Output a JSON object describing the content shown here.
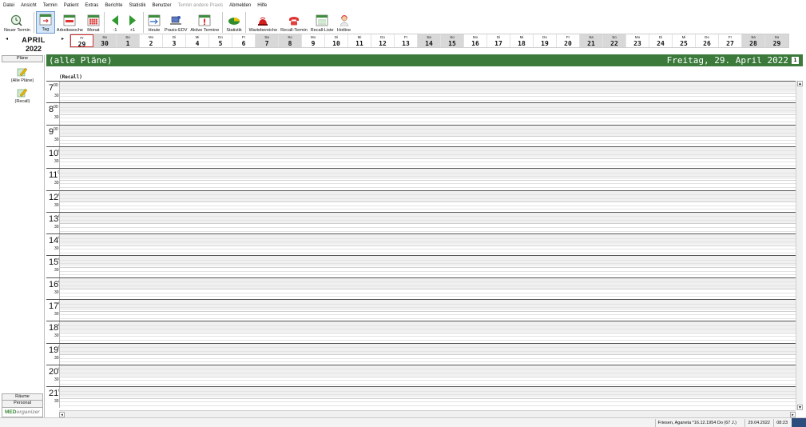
{
  "menu": [
    "Datei",
    "Ansicht",
    "Termin",
    "Patient",
    "Extras",
    "Berichte",
    "Statistik",
    "Benutzer",
    "Termin andere Praxis",
    "Abmelden",
    "Hilfe"
  ],
  "menu_disabled": [
    "Termin andere Praxis"
  ],
  "toolbar": {
    "new_appt": "Neuer Termin",
    "day": "Tag",
    "workweek": "Arbeitswoche",
    "month": "Monat",
    "minus1": "-1",
    "plus1": "+1",
    "today": "Heute",
    "praxis_edv": "Praxis-EDV",
    "active_appts": "Aktive Termine",
    "statistics": "Statistik",
    "waiting_areas": "Wartebereiche",
    "recall_appt": "Recall-Termin",
    "recall_list": "Recall-Liste",
    "hotline": "Hotline"
  },
  "calendar": {
    "month": "APRIL",
    "year": "2022",
    "prev": "◂",
    "next": "▸",
    "days": [
      {
        "dn": "Fr",
        "dd": "29",
        "we": false,
        "sel": true
      },
      {
        "dn": "Sa",
        "dd": "30",
        "we": true
      },
      {
        "dn": "So",
        "dd": "1",
        "we": true
      },
      {
        "dn": "Mo",
        "dd": "2",
        "we": false
      },
      {
        "dn": "Di",
        "dd": "3",
        "we": false
      },
      {
        "dn": "Mi",
        "dd": "4",
        "we": false
      },
      {
        "dn": "Do",
        "dd": "5",
        "we": false
      },
      {
        "dn": "Fr",
        "dd": "6",
        "we": false
      },
      {
        "dn": "Sa",
        "dd": "7",
        "we": true
      },
      {
        "dn": "So",
        "dd": "8",
        "we": true
      },
      {
        "dn": "Mo",
        "dd": "9",
        "we": false
      },
      {
        "dn": "Di",
        "dd": "10",
        "we": false
      },
      {
        "dn": "Mi",
        "dd": "11",
        "we": false
      },
      {
        "dn": "Do",
        "dd": "12",
        "we": false
      },
      {
        "dn": "Fr",
        "dd": "13",
        "we": false
      },
      {
        "dn": "Sa",
        "dd": "14",
        "we": true
      },
      {
        "dn": "So",
        "dd": "15",
        "we": true
      },
      {
        "dn": "Mo",
        "dd": "16",
        "we": false
      },
      {
        "dn": "Di",
        "dd": "17",
        "we": false
      },
      {
        "dn": "Mi",
        "dd": "18",
        "we": false
      },
      {
        "dn": "Do",
        "dd": "19",
        "we": false
      },
      {
        "dn": "Fr",
        "dd": "20",
        "we": false
      },
      {
        "dn": "Sa",
        "dd": "21",
        "we": true
      },
      {
        "dn": "So",
        "dd": "22",
        "we": true
      },
      {
        "dn": "Mo",
        "dd": "23",
        "we": false
      },
      {
        "dn": "Di",
        "dd": "24",
        "we": false
      },
      {
        "dn": "Mi",
        "dd": "25",
        "we": false
      },
      {
        "dn": "Do",
        "dd": "26",
        "we": false
      },
      {
        "dn": "Fr",
        "dd": "27",
        "we": false
      },
      {
        "dn": "Sa",
        "dd": "28",
        "we": true
      },
      {
        "dn": "So",
        "dd": "29",
        "we": true
      }
    ]
  },
  "sidebar": {
    "plans_tab": "Pläne",
    "items": [
      "(Alle Pläne)",
      "(Recall)"
    ],
    "rooms_tab": "Räume",
    "staff_tab": "Personal",
    "brand_a": "MED",
    "brand_b": "organizer"
  },
  "header": {
    "plan": "(alle Pläne)",
    "date": "Freitag, 29. April 2022",
    "cal_icon_text": "1"
  },
  "schedule": {
    "column": "(Recall)",
    "hours": [
      "7",
      "8",
      "9",
      "10",
      "11",
      "12",
      "13",
      "14",
      "15",
      "16",
      "17",
      "18",
      "19",
      "20",
      "21"
    ],
    "minute_top": "00",
    "minute_half": "30"
  },
  "status": {
    "patient": "Friesen, Aganeta *16.12.1954 Do (67 J.)",
    "date": "29.04.2022",
    "time": "08:23"
  },
  "colors": {
    "header_green": "#3b7a3b",
    "selected_day_border": "#d23030",
    "weekend": "#d8d8d8"
  }
}
